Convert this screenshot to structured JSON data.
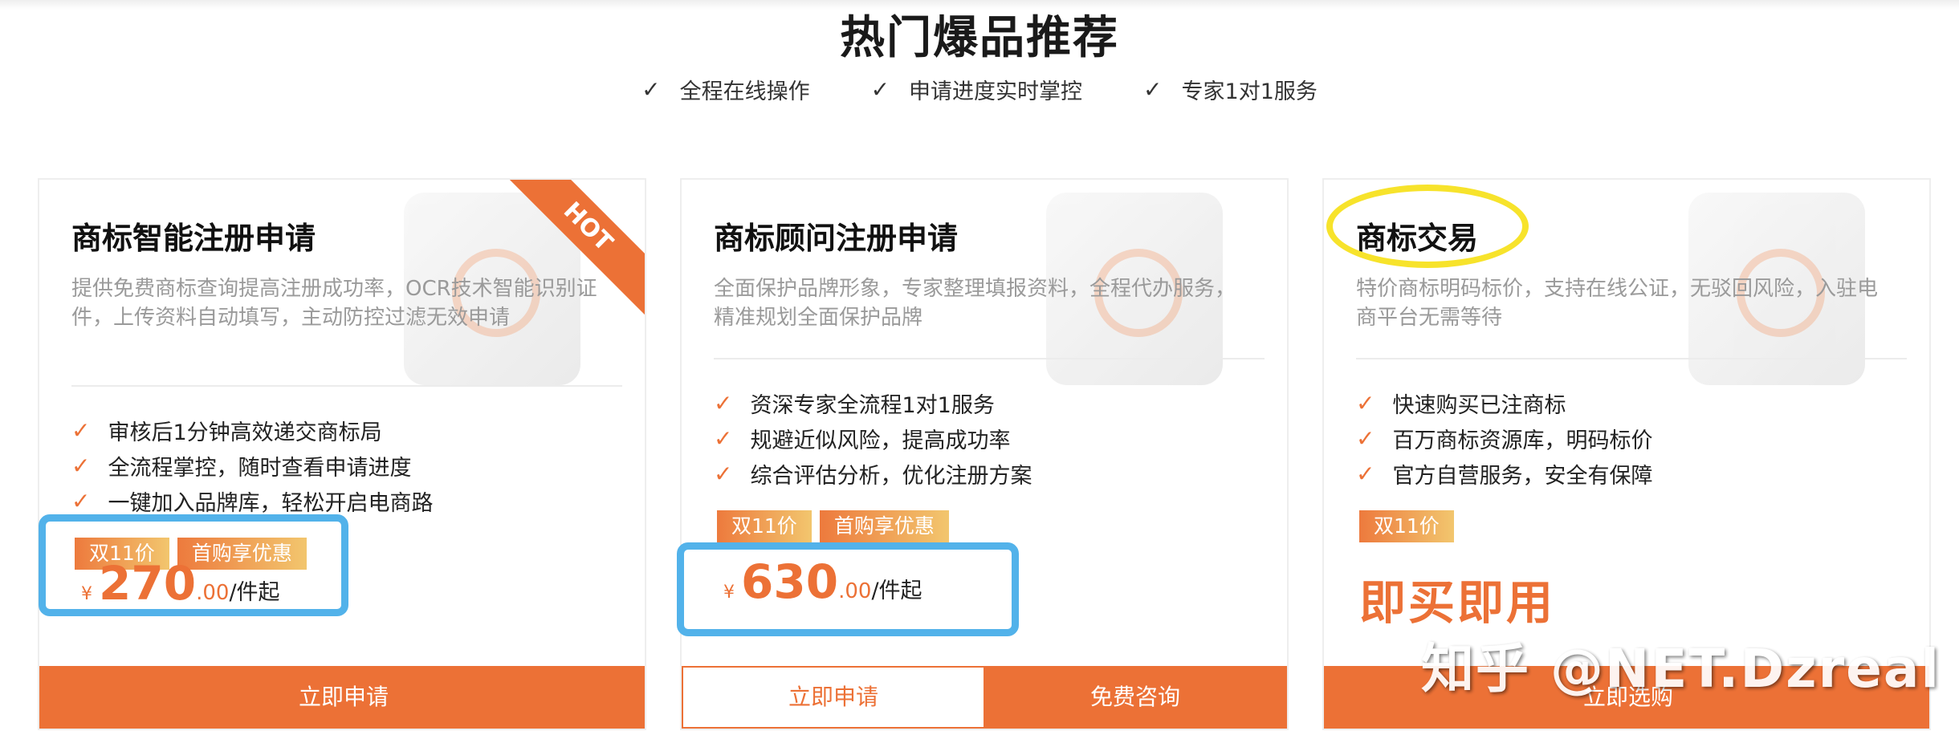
{
  "section": {
    "title": "热门爆品推荐",
    "features": [
      "全程在线操作",
      "申请进度实时掌控",
      "专家1对1服务"
    ]
  },
  "cards": [
    {
      "title": "商标智能注册申请",
      "desc": "提供免费商标查询提高注册成功率，OCR技术智能识别证件，上传资料自动填写，主动防控过滤无效申请",
      "badge": "HOT",
      "benefits": [
        "审核后1分钟高效递交商标局",
        "全流程掌控，随时查看申请进度",
        "一键加入品牌库，轻松开启电商路"
      ],
      "tags": [
        "双11价",
        "首购享优惠"
      ],
      "price": {
        "currency": "¥",
        "integer": "270",
        "decimal": ".00",
        "unit": "/件起"
      },
      "button": "立即申请"
    },
    {
      "title": "商标顾问注册申请",
      "desc": "全面保护品牌形象，专家整理填报资料，全程代办服务，精准规划全面保护品牌",
      "benefits": [
        "资深专家全流程1对1服务",
        "规避近似风险，提高成功率",
        "综合评估分析，优化注册方案"
      ],
      "tags": [
        "双11价",
        "首购享优惠"
      ],
      "price": {
        "currency": "¥",
        "integer": "630",
        "decimal": ".00",
        "unit": "/件起"
      },
      "button_primary": "立即申请",
      "button_secondary": "免费咨询"
    },
    {
      "title": "商标交易",
      "desc": "特价商标明码标价，支持在线公证，无驳回风险，入驻电商平台无需等待",
      "benefits": [
        "快速购买已注商标",
        "百万商标资源库，明码标价",
        "官方自营服务，安全有保障"
      ],
      "tags": [
        "双11价"
      ],
      "slogan": "即买即用",
      "button": "立即选购"
    }
  ],
  "watermark": "知乎 @NET.Dzreal",
  "colors": {
    "accent": "#ec7136",
    "highlight_box": "#52b2ea",
    "highlight_oval": "#f7e32b"
  },
  "icons": {
    "feature_check": "check-icon",
    "benefit_check": "tick-icon"
  }
}
